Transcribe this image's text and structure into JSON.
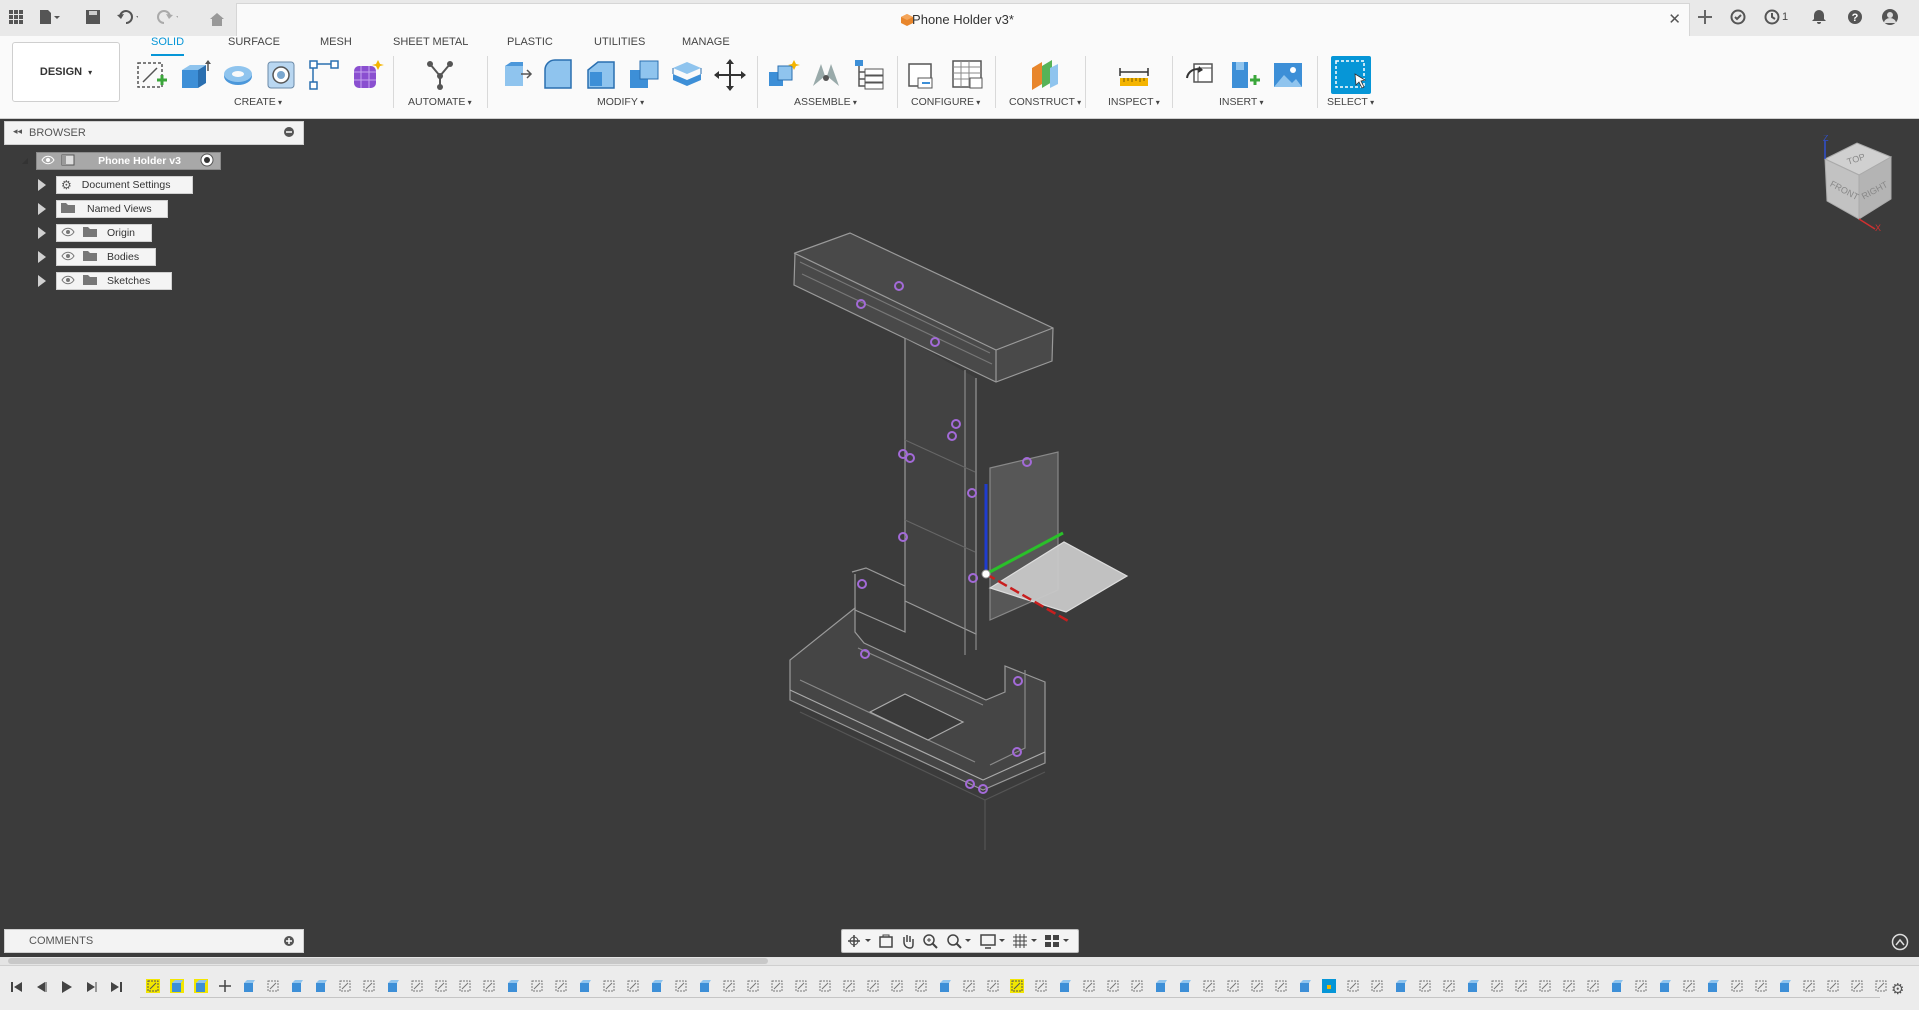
{
  "app": {
    "document_title": "Phone Holder v3*",
    "job_count": "1"
  },
  "workspace": {
    "mode": "DESIGN"
  },
  "tabs": [
    {
      "label": "SOLID",
      "active": true
    },
    {
      "label": "SURFACE"
    },
    {
      "label": "MESH"
    },
    {
      "label": "SHEET METAL"
    },
    {
      "label": "PLASTIC"
    },
    {
      "label": "UTILITIES"
    },
    {
      "label": "MANAGE"
    }
  ],
  "groups": {
    "create": "CREATE",
    "automate": "AUTOMATE",
    "modify": "MODIFY",
    "assemble": "ASSEMBLE",
    "configure": "CONFIGURE",
    "construct": "CONSTRUCT",
    "inspect": "INSPECT",
    "insert": "INSERT",
    "select": "SELECT"
  },
  "browser": {
    "title": "BROWSER",
    "root": "Phone Holder v3",
    "items": [
      {
        "label": "Document Settings",
        "icon": "gear-icon"
      },
      {
        "label": "Named Views",
        "icon": "folder-icon"
      },
      {
        "label": "Origin",
        "icon": "folder-icon"
      },
      {
        "label": "Bodies",
        "icon": "folder-icon"
      },
      {
        "label": "Sketches",
        "icon": "folder-icon"
      }
    ]
  },
  "comments": {
    "title": "COMMENTS"
  },
  "viewcube": {
    "top": "TOP",
    "front": "FRONT",
    "right": "RIGHT",
    "axis_z": "Z",
    "axis_x": "X"
  },
  "colors": {
    "accent": "#0696d7",
    "canvas": "#3b3b3b",
    "sketch_highlight": "#f2e600",
    "point": "#a36ad8"
  }
}
